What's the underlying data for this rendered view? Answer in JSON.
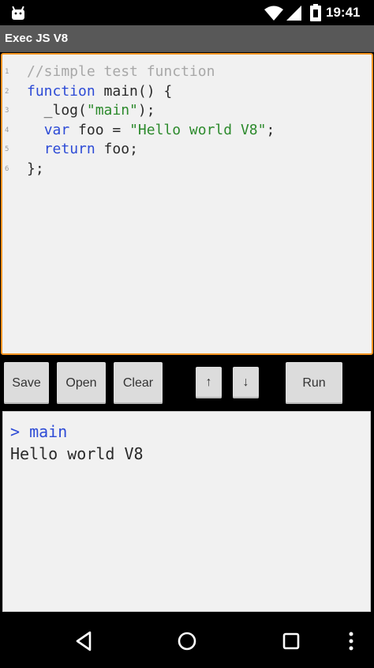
{
  "status_bar": {
    "time": "19:41",
    "icons": [
      "android-icon",
      "wifi-icon",
      "signal-icon",
      "battery-icon"
    ]
  },
  "app": {
    "title": "Exec JS V8"
  },
  "editor": {
    "border_color": "#f39421",
    "lines": [
      {
        "num": "1",
        "tokens": [
          {
            "t": "//simple test function",
            "c": "comment"
          }
        ]
      },
      {
        "num": "2",
        "tokens": [
          {
            "t": "function",
            "c": "keyword"
          },
          {
            "t": " main() {",
            "c": "plain"
          }
        ]
      },
      {
        "num": "3",
        "tokens": [
          {
            "t": "  _log(",
            "c": "plain"
          },
          {
            "t": "\"main\"",
            "c": "string"
          },
          {
            "t": ");",
            "c": "plain"
          }
        ]
      },
      {
        "num": "4",
        "tokens": [
          {
            "t": "  ",
            "c": "plain"
          },
          {
            "t": "var",
            "c": "keyword"
          },
          {
            "t": " foo = ",
            "c": "plain"
          },
          {
            "t": "\"Hello world V8\"",
            "c": "string"
          },
          {
            "t": ";",
            "c": "plain"
          }
        ]
      },
      {
        "num": "5",
        "tokens": [
          {
            "t": "  ",
            "c": "plain"
          },
          {
            "t": "return",
            "c": "keyword"
          },
          {
            "t": " foo;",
            "c": "plain"
          }
        ]
      },
      {
        "num": "6",
        "tokens": [
          {
            "t": "};",
            "c": "plain"
          }
        ]
      }
    ]
  },
  "toolbar": {
    "save_label": "Save",
    "open_label": "Open",
    "clear_label": "Clear",
    "up_label": "↑",
    "down_label": "↓",
    "run_label": "Run"
  },
  "console": {
    "prompt_line": "> main",
    "output_line": "Hello world V8"
  },
  "nav_bar": {
    "icons": [
      "back-icon",
      "home-icon",
      "recents-icon",
      "overflow-menu-icon"
    ]
  },
  "colors": {
    "accent": "#f39421",
    "keyword": "#2d4bd6",
    "string": "#2c8a2c",
    "comment": "#a8a8a8"
  }
}
